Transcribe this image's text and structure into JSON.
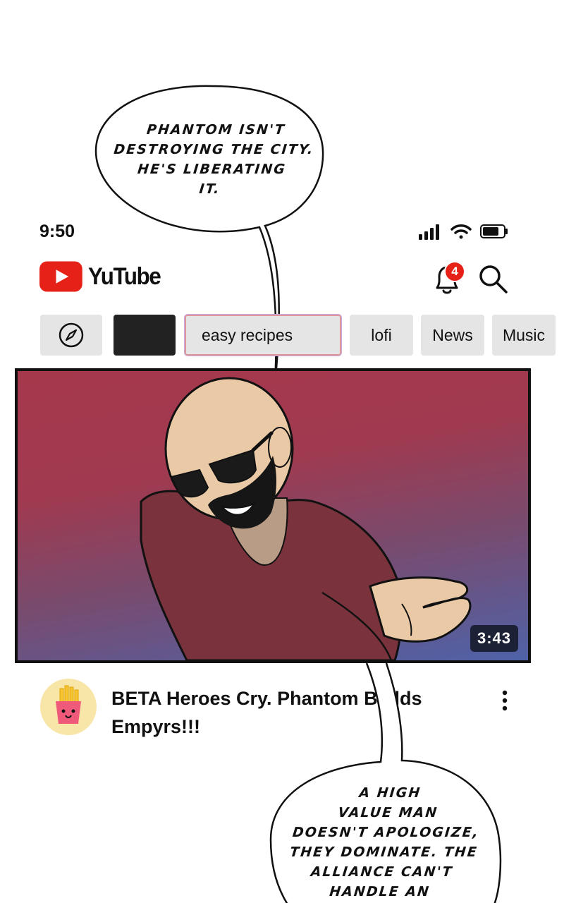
{
  "speech_bubble_top": {
    "lines": [
      "PHANTOM ISN'T",
      "DESTROYING THE CITY.",
      "HE'S LIBERATING",
      "IT."
    ]
  },
  "speech_bubble_bottom": {
    "lines": [
      "A HIGH",
      "VALUE MAN",
      "DOESN'T  APOLOGIZE,",
      "THEY DOMINATE. THE",
      "ALLIANCE CAN'T",
      "HANDLE AN"
    ]
  },
  "status_bar": {
    "time": "9:50",
    "icons": [
      "signal-icon",
      "wifi-icon",
      "battery-icon"
    ]
  },
  "header": {
    "logo_text": "YuTube",
    "notification_count": "4",
    "icons": [
      "play-logo-icon",
      "bell-icon",
      "search-icon"
    ]
  },
  "chips": {
    "explore_icon": "compass-icon",
    "search_value": "easy recipes",
    "items": [
      "lofi",
      "News",
      "Music"
    ]
  },
  "video": {
    "duration": "3:43",
    "title": "BETA Heroes Cry. Phantom Builds Empyrs!!!",
    "more_icon": "kebab-menu-icon"
  },
  "colors": {
    "brand_red": "#e62117",
    "chip_bg": "#e5e5e5",
    "thumb_top": "#a6384c",
    "thumb_bottom": "#4f62a8"
  }
}
